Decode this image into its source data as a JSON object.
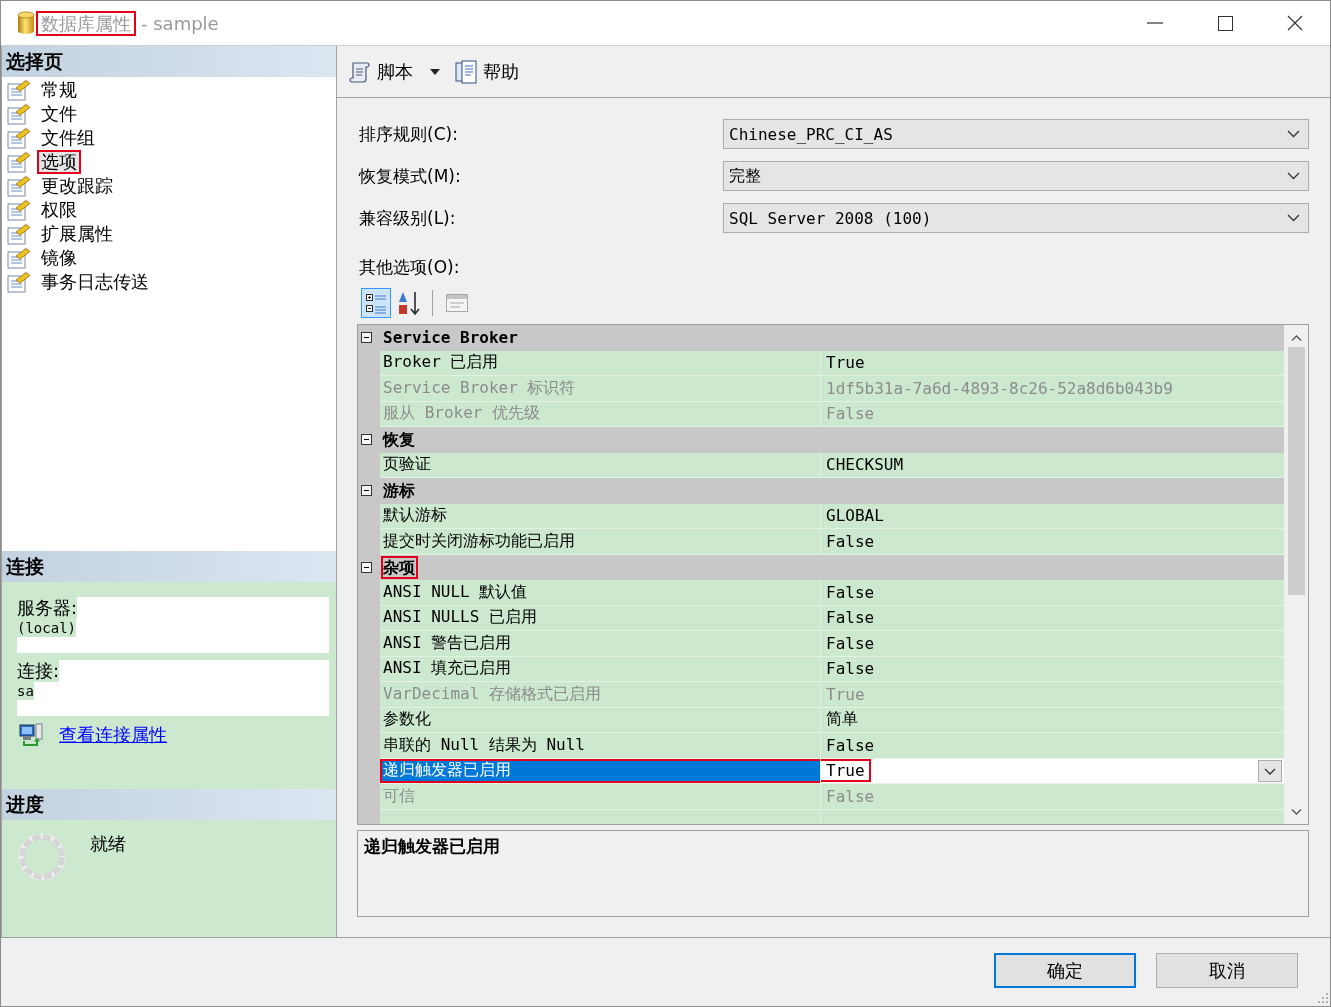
{
  "window": {
    "title": {
      "text": "数据库属性",
      "highlighted": true
    },
    "subtitle": "- sample"
  },
  "sidebar": {
    "pages": {
      "heading": "选择页",
      "items": [
        {
          "label": "常规",
          "selected": false,
          "highlighted": false
        },
        {
          "label": "文件",
          "selected": false,
          "highlighted": false
        },
        {
          "label": "文件组",
          "selected": false,
          "highlighted": false
        },
        {
          "label": "选项",
          "selected": true,
          "highlighted": true
        },
        {
          "label": "更改跟踪",
          "selected": false,
          "highlighted": false
        },
        {
          "label": "权限",
          "selected": false,
          "highlighted": false
        },
        {
          "label": "扩展属性",
          "selected": false,
          "highlighted": false
        },
        {
          "label": "镜像",
          "selected": false,
          "highlighted": false
        },
        {
          "label": "事务日志传送",
          "selected": false,
          "highlighted": false
        }
      ]
    },
    "connection": {
      "heading": "连接",
      "fields": [
        {
          "label": "服务器:",
          "value": "(local)"
        },
        {
          "label": "连接:",
          "value": "sa"
        }
      ],
      "link": "查看连接属性"
    },
    "progress": {
      "heading": "进度",
      "status": "就绪"
    }
  },
  "toolbar": {
    "script_button": "脚本",
    "help_button": "帮助"
  },
  "options": [
    {
      "label": "排序规则(C):",
      "value": "Chinese_PRC_CI_AS"
    },
    {
      "label": "恢复模式(M):",
      "value": "完整"
    },
    {
      "label": "兼容级别(L):",
      "value": "SQL Server 2008 (100)"
    }
  ],
  "other_options_label": "其他选项(O):",
  "grid_toolbar": [
    {
      "kind": "categorized",
      "selected": true,
      "disabled": false
    },
    {
      "kind": "alphabetical",
      "selected": false,
      "disabled": false
    },
    {
      "kind": "property-pages",
      "selected": false,
      "disabled": true
    }
  ],
  "property_grid": {
    "categories": [
      {
        "name": "Service Broker",
        "expanded": true,
        "highlighted": false,
        "properties": [
          {
            "name": "Broker 已启用",
            "value": "True",
            "disabled": false,
            "selected": false,
            "highlighted": false
          },
          {
            "name": "Service Broker 标识符",
            "value": "1df5b31a-7a6d-4893-8c26-52a8d6b043b9",
            "disabled": true,
            "selected": false,
            "highlighted": false
          },
          {
            "name": "服从 Broker 优先级",
            "value": "False",
            "disabled": true,
            "selected": false,
            "highlighted": false
          }
        ]
      },
      {
        "name": "恢复",
        "expanded": true,
        "highlighted": false,
        "properties": [
          {
            "name": "页验证",
            "value": "CHECKSUM",
            "disabled": false,
            "selected": false,
            "highlighted": false
          }
        ]
      },
      {
        "name": "游标",
        "expanded": true,
        "highlighted": false,
        "properties": [
          {
            "name": "默认游标",
            "value": "GLOBAL",
            "disabled": false,
            "selected": false,
            "highlighted": false
          },
          {
            "name": "提交时关闭游标功能已启用",
            "value": "False",
            "disabled": false,
            "selected": false,
            "highlighted": false
          }
        ]
      },
      {
        "name": "杂项",
        "expanded": true,
        "highlighted": true,
        "properties": [
          {
            "name": "ANSI NULL 默认值",
            "value": "False",
            "disabled": false,
            "selected": false,
            "highlighted": false
          },
          {
            "name": "ANSI NULLS 已启用",
            "value": "False",
            "disabled": false,
            "selected": false,
            "highlighted": false
          },
          {
            "name": "ANSI 警告已启用",
            "value": "False",
            "disabled": false,
            "selected": false,
            "highlighted": false
          },
          {
            "name": "ANSI 填充已启用",
            "value": "False",
            "disabled": false,
            "selected": false,
            "highlighted": false
          },
          {
            "name": "VarDecimal 存储格式已启用",
            "value": "True",
            "disabled": true,
            "selected": false,
            "highlighted": false
          },
          {
            "name": "参数化",
            "value": "简单",
            "disabled": false,
            "selected": false,
            "highlighted": false
          },
          {
            "name": "串联的 Null 结果为 Null",
            "value": "False",
            "disabled": false,
            "selected": false,
            "highlighted": false
          },
          {
            "name": "递归触发器已启用",
            "value": "True",
            "disabled": false,
            "selected": true,
            "highlighted": true
          },
          {
            "name": "可信",
            "value": "False",
            "disabled": true,
            "selected": false,
            "highlighted": false
          }
        ]
      }
    ]
  },
  "description": {
    "title": "递归触发器已启用"
  },
  "buttons": [
    {
      "label": "确定",
      "default": true
    },
    {
      "label": "取消",
      "default": false
    }
  ]
}
